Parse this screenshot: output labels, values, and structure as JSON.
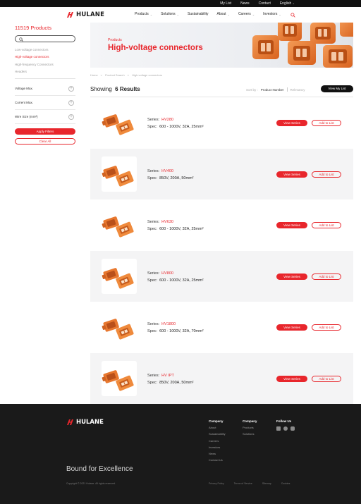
{
  "topbar": {
    "links": [
      "My List",
      "News",
      "Contact",
      "English"
    ]
  },
  "header": {
    "brand": "HULANE",
    "nav": [
      "Products",
      "Solutions",
      "Sustainability",
      "About",
      "Careers",
      "Investors"
    ]
  },
  "sidebar": {
    "count_title": "11519 Products",
    "search_placeholder": "",
    "categories": [
      "Low-voltage connectors",
      "High-voltage connectors",
      "High-frequency Connectors",
      "Headers"
    ],
    "filters": [
      "Voltage Max.",
      "Current Max.",
      "Wire Size (mm²)"
    ],
    "apply_label": "Apply Filters",
    "clear_label": "Clear All"
  },
  "hero": {
    "kicker": "Products",
    "title": "High-voltage connectors"
  },
  "breadcrumb": [
    "Home",
    ">",
    "Product Search",
    ">",
    "High-voltage connectors"
  ],
  "results": {
    "showing_label": "Showing",
    "count_text": "6 Results",
    "sort_label": "Sort by :",
    "sort_options": [
      "Product Number",
      "Relevancy"
    ],
    "mylist_label": "View My List"
  },
  "products": [
    {
      "series": "HV280",
      "spec": "600 - 1000V, 32A, 25mm²"
    },
    {
      "series": "HV400",
      "spec": "850V, 200A, 50mm²"
    },
    {
      "series": "HV630",
      "spec": "600 - 1000V, 32A, 25mm²"
    },
    {
      "series": "HV800",
      "spec": "600 - 1000V, 32A, 25mm²"
    },
    {
      "series": "HV1800",
      "spec": "600 - 1000V, 32A, 70mm²"
    },
    {
      "series": "HV IPT",
      "spec": "850V, 200A, 50mm²"
    }
  ],
  "row_labels": {
    "series": "Series:",
    "spec": "Spec:",
    "view": "View Series",
    "add": "Add to List"
  },
  "footer": {
    "brand": "HULANE",
    "col1": {
      "heading": "Company",
      "links": [
        "About",
        "Sustainability",
        "Careers",
        "Investors",
        "News",
        "Contact Us"
      ]
    },
    "col2": {
      "heading": "Company",
      "links": [
        "Products",
        "Solutions"
      ]
    },
    "col3": {
      "heading": "Follow Us"
    },
    "tagline": "Bound for Excellence",
    "copyright": "Copyright © 2021 Hulane. All rights reserved.",
    "legal": [
      "Privacy Policy",
      "Terms of Service",
      "Sitemap",
      "Cookies"
    ]
  },
  "colors": {
    "accent": "#e8262c",
    "connector": "#e8782f",
    "footer": "#1a1a1a"
  },
  "icons": [
    "hulane-logo-icon",
    "search-icon",
    "chevron-down-icon",
    "plus-icon",
    "linkedin-icon",
    "wechat-icon",
    "youtube-icon"
  ]
}
